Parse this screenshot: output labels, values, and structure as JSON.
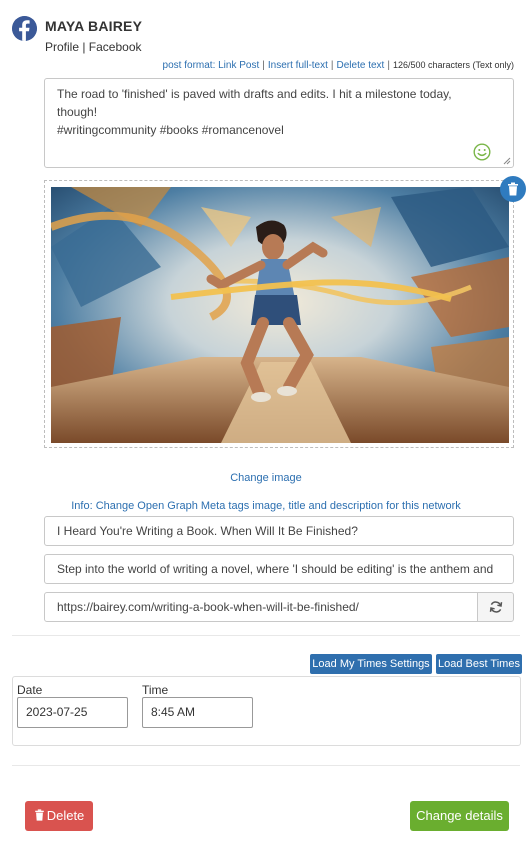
{
  "account": {
    "name": "MAYA BAIREY",
    "subtitle": "Profile | Facebook",
    "network_icon": "facebook-icon",
    "brand_color": "#3b5998"
  },
  "format_bar": {
    "post_format_link": "post format: Link Post",
    "insert_fulltext_link": "Insert full-text",
    "delete_text_link": "Delete text",
    "separator": "|",
    "char_count": "126/500 characters (Text only)"
  },
  "post": {
    "text": "The road to 'finished' is paved with drafts and edits. I hit a milestone today, though!\n#writingcommunity #books #romancenovel",
    "emoji_icon": "smile-icon"
  },
  "image": {
    "alt_description": "runner-illustration",
    "delete_icon": "trash-icon",
    "change_link": "Change image"
  },
  "og": {
    "info": "Info: Change Open Graph Meta tags image, title and description for this network",
    "title": "I Heard You're Writing a Book. When Will It Be Finished?",
    "description": "Step into the world of writing a novel, where 'I should be editing' is the anthem and",
    "url": "https://bairey.com/writing-a-book-when-will-it-be-finished/",
    "refresh_icon": "refresh-icon"
  },
  "schedule": {
    "load_my_times": "Load My Times Settings",
    "load_best_times": "Load Best Times",
    "date_label": "Date",
    "date_value": "2023-07-25",
    "time_label": "Time",
    "time_value": "8:45 AM"
  },
  "actions": {
    "delete": "Delete",
    "change_details": "Change details"
  },
  "colors": {
    "link": "#2c6fb0",
    "primary_button": "#2f6fae",
    "danger": "#d9534f",
    "success": "#6aae2f"
  }
}
